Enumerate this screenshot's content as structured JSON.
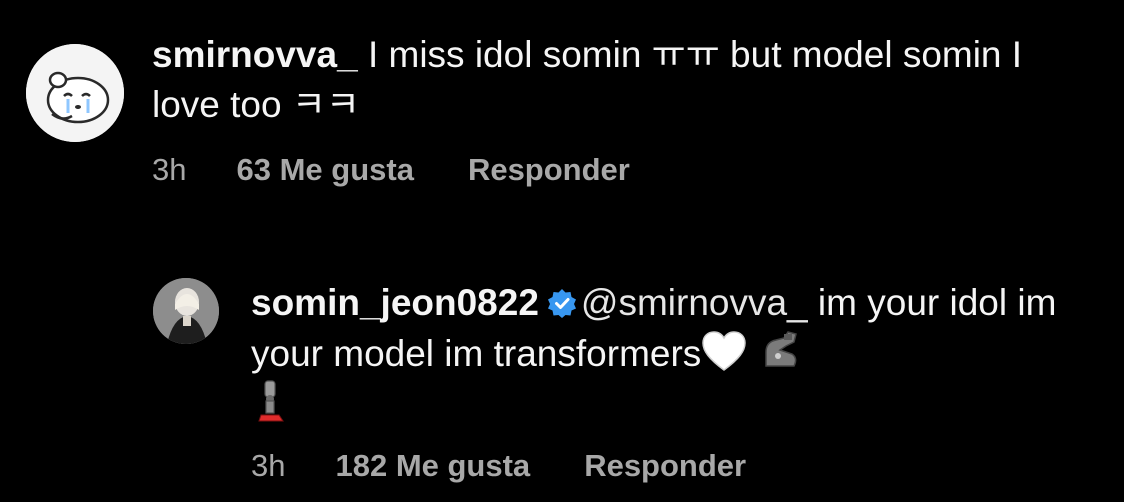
{
  "comments": [
    {
      "username": "smirnovva_",
      "text": "I miss idol somin ㅠㅠ but model somin I love too ㅋㅋ",
      "time": "3h",
      "likes": "63 Me gusta",
      "reply": "Responder"
    },
    {
      "username": "somin_jeon0822",
      "mention": "@smirnovva_",
      "text": "im your idol im your model im transformers",
      "time": "3h",
      "likes": "182 Me gusta",
      "reply": "Responder"
    }
  ],
  "icons": {
    "verified": "verified-badge-icon",
    "heart": "white-heart-emoji",
    "arm": "mechanical-arm-emoji",
    "leg": "mechanical-leg-emoji"
  },
  "colors": {
    "background": "#000000",
    "text": "#f5f5f5",
    "meta": "#a8a8a8",
    "verified": "#3897f0"
  }
}
